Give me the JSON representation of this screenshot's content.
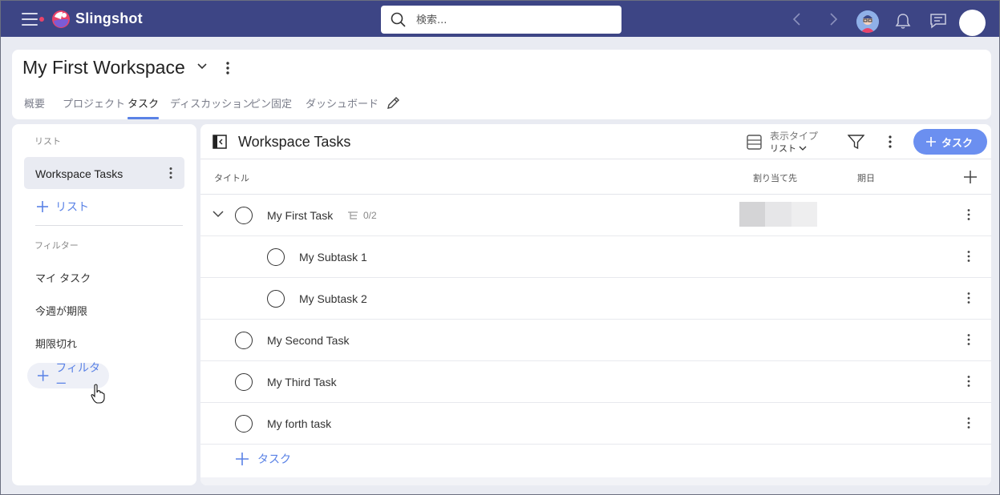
{
  "topbar": {
    "brand": "Slingshot",
    "search_placeholder": "検索...",
    "colors": {
      "background": "#3d4585",
      "accent_dot": "#e9436a"
    },
    "icons": [
      "menu-icon",
      "slingshot-logo-icon",
      "search-icon",
      "chevron-left-icon",
      "chevron-right-icon",
      "user-avatar",
      "bell-icon",
      "chat-icon",
      "profile-avatar"
    ]
  },
  "workspace": {
    "title": "My First Workspace",
    "tabs": [
      {
        "label": "概要"
      },
      {
        "label": "プロジェクト"
      },
      {
        "label": "タスク",
        "active": true
      },
      {
        "label": "ディスカッション"
      },
      {
        "label": "ピン固定"
      },
      {
        "label": "ダッシュボード"
      }
    ]
  },
  "sidebar": {
    "lists_header": "リスト",
    "selected_list": "Workspace Tasks",
    "add_list_label": "リスト",
    "filters_header": "フィルター",
    "filters": [
      {
        "label": "マイ タスク"
      },
      {
        "label": "今週が期限"
      },
      {
        "label": "期限切れ"
      }
    ],
    "add_filter_label": "フィルター"
  },
  "main": {
    "title": "Workspace Tasks",
    "view_type_label": "表示タイプ",
    "view_type_value": "リスト",
    "add_task_label": "タスク",
    "columns": {
      "title": "タイトル",
      "assignee": "割り当て先",
      "due": "期日"
    },
    "tasks": [
      {
        "name": "My First Task",
        "subtasks": "0/2",
        "expanded": true
      },
      {
        "name": "My Subtask 1",
        "subtask": true
      },
      {
        "name": "My Subtask 2",
        "subtask": true
      },
      {
        "name": "My Second Task"
      },
      {
        "name": "My Third Task"
      },
      {
        "name": "My forth task"
      }
    ],
    "add_row_label": "タスク",
    "accent": "#5a82e6"
  }
}
